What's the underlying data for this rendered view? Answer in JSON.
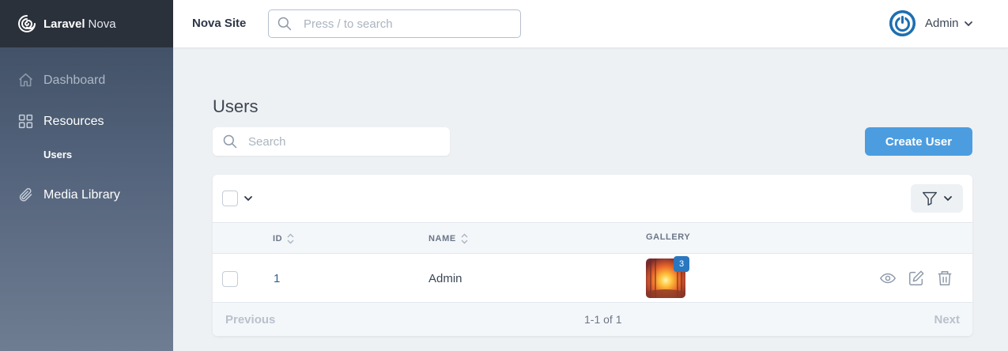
{
  "brand": {
    "name_bold": "Laravel",
    "name_rest": "Nova"
  },
  "sidebar": {
    "items": [
      {
        "label": "Dashboard",
        "icon": "home-icon"
      },
      {
        "label": "Resources",
        "icon": "grid-icon"
      },
      {
        "label": "Users"
      },
      {
        "label": "Media Library",
        "icon": "paperclip-icon"
      }
    ]
  },
  "header": {
    "site_name": "Nova Site",
    "search_placeholder": "Press / to search",
    "user_name": "Admin"
  },
  "page": {
    "title": "Users",
    "search_placeholder": "Search",
    "create_label": "Create User"
  },
  "table": {
    "columns": [
      {
        "label": "ID",
        "sortable": true
      },
      {
        "label": "NAME",
        "sortable": true
      },
      {
        "label": "GALLERY",
        "sortable": false
      }
    ],
    "rows": [
      {
        "id": "1",
        "name": "Admin",
        "gallery_count": "3"
      }
    ]
  },
  "pagination": {
    "previous": "Previous",
    "info": "1-1 of 1",
    "next": "Next"
  },
  "colors": {
    "accent": "#4c9de0",
    "sidebar_top": "#3c4b5f",
    "badge": "#2a77c0"
  }
}
